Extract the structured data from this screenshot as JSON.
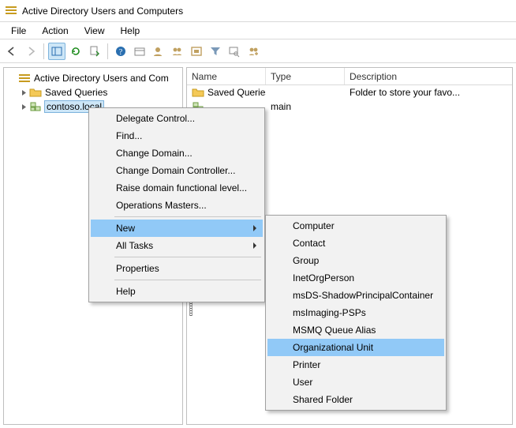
{
  "title": "Active Directory Users and Computers",
  "menubar": {
    "file": "File",
    "action": "Action",
    "view": "View",
    "help": "Help"
  },
  "tree": {
    "root": "Active Directory Users and Com",
    "saved_queries": "Saved Queries",
    "domain": "contoso.local"
  },
  "list": {
    "headers": {
      "name": "Name",
      "type": "Type",
      "desc": "Description"
    },
    "rows": [
      {
        "name": "Saved Queries",
        "type": "",
        "desc": "Folder to store your favo..."
      },
      {
        "name": "",
        "type": "main",
        "desc": ""
      }
    ]
  },
  "ctx1": {
    "items": [
      {
        "label": "Delegate Control...",
        "submenu": false
      },
      {
        "label": "Find...",
        "submenu": false
      },
      {
        "label": "Change Domain...",
        "submenu": false
      },
      {
        "label": "Change Domain Controller...",
        "submenu": false
      },
      {
        "label": "Raise domain functional level...",
        "submenu": false
      },
      {
        "label": "Operations Masters...",
        "submenu": false
      },
      {
        "sep": true
      },
      {
        "label": "New",
        "submenu": true,
        "highlight": true
      },
      {
        "label": "All Tasks",
        "submenu": true
      },
      {
        "sep": true
      },
      {
        "label": "Properties",
        "submenu": false
      },
      {
        "sep": true
      },
      {
        "label": "Help",
        "submenu": false
      }
    ]
  },
  "ctx2": {
    "items": [
      {
        "label": "Computer"
      },
      {
        "label": "Contact"
      },
      {
        "label": "Group"
      },
      {
        "label": "InetOrgPerson"
      },
      {
        "label": "msDS-ShadowPrincipalContainer"
      },
      {
        "label": "msImaging-PSPs"
      },
      {
        "label": "MSMQ Queue Alias"
      },
      {
        "label": "Organizational Unit",
        "highlight": true
      },
      {
        "label": "Printer"
      },
      {
        "label": "User"
      },
      {
        "label": "Shared Folder"
      }
    ]
  }
}
